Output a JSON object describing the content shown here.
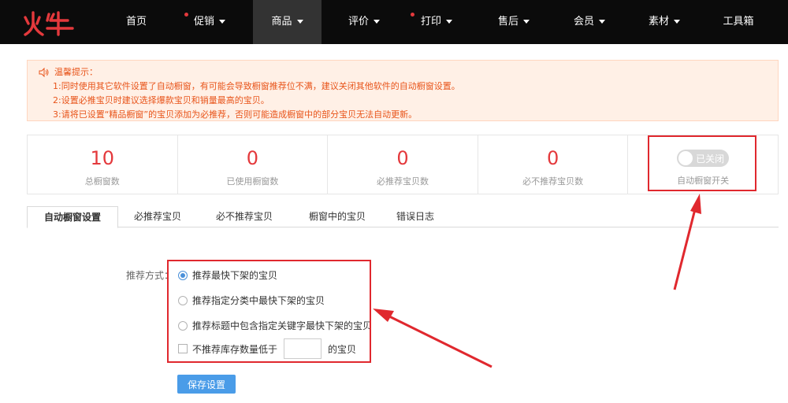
{
  "brand": {
    "logo_text": "火牛",
    "color": "#e4393c"
  },
  "nav": {
    "items": [
      {
        "label": "首页",
        "caret": false,
        "dot": false
      },
      {
        "label": "促销",
        "caret": true,
        "dot": true
      },
      {
        "label": "商品",
        "caret": true,
        "dot": false,
        "active": true
      },
      {
        "label": "评价",
        "caret": true,
        "dot": false
      },
      {
        "label": "打印",
        "caret": true,
        "dot": true
      },
      {
        "label": "售后",
        "caret": true,
        "dot": false
      },
      {
        "label": "会员",
        "caret": true,
        "dot": false
      },
      {
        "label": "素材",
        "caret": true,
        "dot": false
      },
      {
        "label": "工具箱",
        "caret": false,
        "dot": false
      }
    ]
  },
  "notice": {
    "title": "温馨提示：",
    "lines": [
      "1:同时使用其它软件设置了自动橱窗，有可能会导致橱窗推荐位不满，建议关闭其他软件的自动橱窗设置。",
      "2:设置必推宝贝时建议选择爆款宝贝和销量最高的宝贝。",
      "3:请将已设置“精品橱窗”的宝贝添加为必推荐，否则可能造成橱窗中的部分宝贝无法自动更新。"
    ]
  },
  "stats": [
    {
      "value": "10",
      "label": "总橱窗数"
    },
    {
      "value": "0",
      "label": "已使用橱窗数"
    },
    {
      "value": "0",
      "label": "必推荐宝贝数"
    },
    {
      "value": "0",
      "label": "必不推荐宝贝数"
    }
  ],
  "auto_switch": {
    "state_label": "已关闭",
    "label": "自动橱窗开关",
    "on": false
  },
  "tabs": [
    "自动橱窗设置",
    "必推荐宝贝",
    "必不推荐宝贝",
    "橱窗中的宝贝",
    "错误日志"
  ],
  "form": {
    "method_label": "推荐方式：",
    "options": [
      {
        "label": "推荐最快下架的宝贝",
        "selected": true
      },
      {
        "label": "推荐指定分类中最快下架的宝贝",
        "selected": false
      },
      {
        "label": "推荐标题中包含指定关键字最快下架的宝贝",
        "selected": false
      }
    ],
    "stock_prefix": "不推荐库存数量低于",
    "stock_value": "",
    "stock_suffix": "的宝贝",
    "save_label": "保存设置"
  },
  "colors": {
    "accent": "#e4393c",
    "notice_text": "#e8541a",
    "notice_bg": "#fff0e6",
    "button": "#4a9ce8",
    "highlight": "#e0282e"
  }
}
